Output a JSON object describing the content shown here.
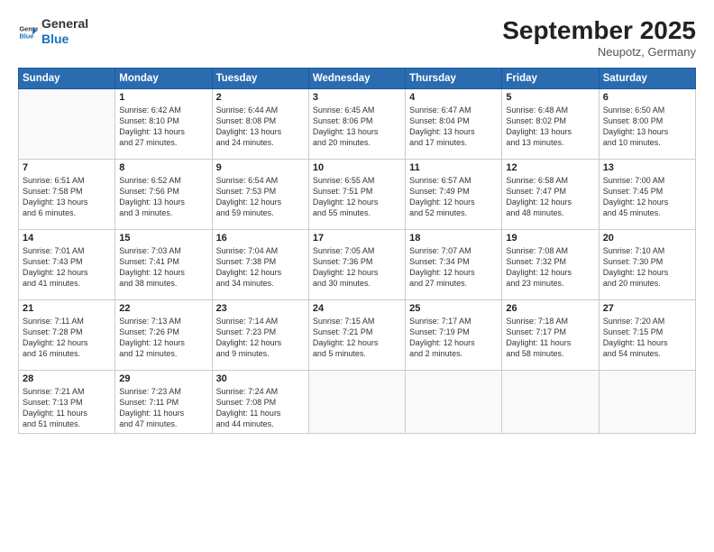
{
  "header": {
    "logo_general": "General",
    "logo_blue": "Blue",
    "month_year": "September 2025",
    "location": "Neupotz, Germany"
  },
  "weekdays": [
    "Sunday",
    "Monday",
    "Tuesday",
    "Wednesday",
    "Thursday",
    "Friday",
    "Saturday"
  ],
  "weeks": [
    [
      {
        "day": "",
        "info": ""
      },
      {
        "day": "1",
        "info": "Sunrise: 6:42 AM\nSunset: 8:10 PM\nDaylight: 13 hours\nand 27 minutes."
      },
      {
        "day": "2",
        "info": "Sunrise: 6:44 AM\nSunset: 8:08 PM\nDaylight: 13 hours\nand 24 minutes."
      },
      {
        "day": "3",
        "info": "Sunrise: 6:45 AM\nSunset: 8:06 PM\nDaylight: 13 hours\nand 20 minutes."
      },
      {
        "day": "4",
        "info": "Sunrise: 6:47 AM\nSunset: 8:04 PM\nDaylight: 13 hours\nand 17 minutes."
      },
      {
        "day": "5",
        "info": "Sunrise: 6:48 AM\nSunset: 8:02 PM\nDaylight: 13 hours\nand 13 minutes."
      },
      {
        "day": "6",
        "info": "Sunrise: 6:50 AM\nSunset: 8:00 PM\nDaylight: 13 hours\nand 10 minutes."
      }
    ],
    [
      {
        "day": "7",
        "info": "Sunrise: 6:51 AM\nSunset: 7:58 PM\nDaylight: 13 hours\nand 6 minutes."
      },
      {
        "day": "8",
        "info": "Sunrise: 6:52 AM\nSunset: 7:56 PM\nDaylight: 13 hours\nand 3 minutes."
      },
      {
        "day": "9",
        "info": "Sunrise: 6:54 AM\nSunset: 7:53 PM\nDaylight: 12 hours\nand 59 minutes."
      },
      {
        "day": "10",
        "info": "Sunrise: 6:55 AM\nSunset: 7:51 PM\nDaylight: 12 hours\nand 55 minutes."
      },
      {
        "day": "11",
        "info": "Sunrise: 6:57 AM\nSunset: 7:49 PM\nDaylight: 12 hours\nand 52 minutes."
      },
      {
        "day": "12",
        "info": "Sunrise: 6:58 AM\nSunset: 7:47 PM\nDaylight: 12 hours\nand 48 minutes."
      },
      {
        "day": "13",
        "info": "Sunrise: 7:00 AM\nSunset: 7:45 PM\nDaylight: 12 hours\nand 45 minutes."
      }
    ],
    [
      {
        "day": "14",
        "info": "Sunrise: 7:01 AM\nSunset: 7:43 PM\nDaylight: 12 hours\nand 41 minutes."
      },
      {
        "day": "15",
        "info": "Sunrise: 7:03 AM\nSunset: 7:41 PM\nDaylight: 12 hours\nand 38 minutes."
      },
      {
        "day": "16",
        "info": "Sunrise: 7:04 AM\nSunset: 7:38 PM\nDaylight: 12 hours\nand 34 minutes."
      },
      {
        "day": "17",
        "info": "Sunrise: 7:05 AM\nSunset: 7:36 PM\nDaylight: 12 hours\nand 30 minutes."
      },
      {
        "day": "18",
        "info": "Sunrise: 7:07 AM\nSunset: 7:34 PM\nDaylight: 12 hours\nand 27 minutes."
      },
      {
        "day": "19",
        "info": "Sunrise: 7:08 AM\nSunset: 7:32 PM\nDaylight: 12 hours\nand 23 minutes."
      },
      {
        "day": "20",
        "info": "Sunrise: 7:10 AM\nSunset: 7:30 PM\nDaylight: 12 hours\nand 20 minutes."
      }
    ],
    [
      {
        "day": "21",
        "info": "Sunrise: 7:11 AM\nSunset: 7:28 PM\nDaylight: 12 hours\nand 16 minutes."
      },
      {
        "day": "22",
        "info": "Sunrise: 7:13 AM\nSunset: 7:26 PM\nDaylight: 12 hours\nand 12 minutes."
      },
      {
        "day": "23",
        "info": "Sunrise: 7:14 AM\nSunset: 7:23 PM\nDaylight: 12 hours\nand 9 minutes."
      },
      {
        "day": "24",
        "info": "Sunrise: 7:15 AM\nSunset: 7:21 PM\nDaylight: 12 hours\nand 5 minutes."
      },
      {
        "day": "25",
        "info": "Sunrise: 7:17 AM\nSunset: 7:19 PM\nDaylight: 12 hours\nand 2 minutes."
      },
      {
        "day": "26",
        "info": "Sunrise: 7:18 AM\nSunset: 7:17 PM\nDaylight: 11 hours\nand 58 minutes."
      },
      {
        "day": "27",
        "info": "Sunrise: 7:20 AM\nSunset: 7:15 PM\nDaylight: 11 hours\nand 54 minutes."
      }
    ],
    [
      {
        "day": "28",
        "info": "Sunrise: 7:21 AM\nSunset: 7:13 PM\nDaylight: 11 hours\nand 51 minutes."
      },
      {
        "day": "29",
        "info": "Sunrise: 7:23 AM\nSunset: 7:11 PM\nDaylight: 11 hours\nand 47 minutes."
      },
      {
        "day": "30",
        "info": "Sunrise: 7:24 AM\nSunset: 7:08 PM\nDaylight: 11 hours\nand 44 minutes."
      },
      {
        "day": "",
        "info": ""
      },
      {
        "day": "",
        "info": ""
      },
      {
        "day": "",
        "info": ""
      },
      {
        "day": "",
        "info": ""
      }
    ]
  ]
}
